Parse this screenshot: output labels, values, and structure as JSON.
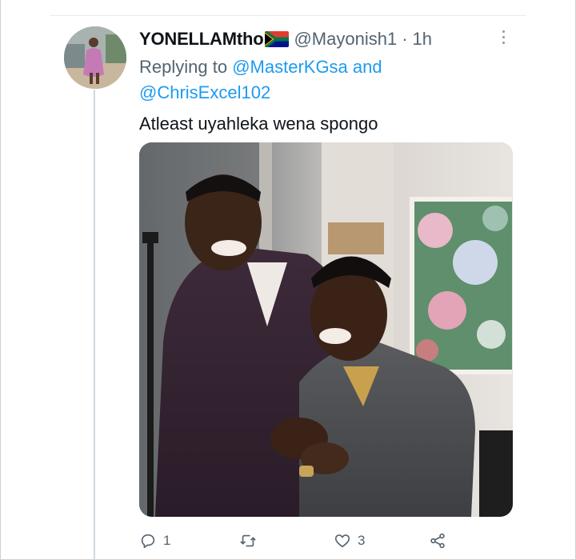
{
  "tweet": {
    "author": {
      "display_name": "YONELLAMtho",
      "handle": "@Mayonish1",
      "flag_icon": "south-africa-flag-icon"
    },
    "separator": "·",
    "timestamp": "1h",
    "replying_prefix": "Replying to",
    "replying_to": [
      "@MasterKGsa",
      "@ChrisExcel102"
    ],
    "replying_joiner": "and",
    "text": "Atleast uyahleka wena spongo",
    "stats": {
      "replies": "1",
      "retweets": "",
      "likes": "3"
    },
    "icons": {
      "reply": "reply-icon",
      "retweet": "retweet-icon",
      "like": "heart-icon",
      "share": "share-icon",
      "more": "more-options-icon"
    }
  },
  "colors": {
    "link": "#1d9bf0",
    "secondary_text": "#536471",
    "primary_text": "#0f1419",
    "thread_line": "#cfd9de"
  }
}
